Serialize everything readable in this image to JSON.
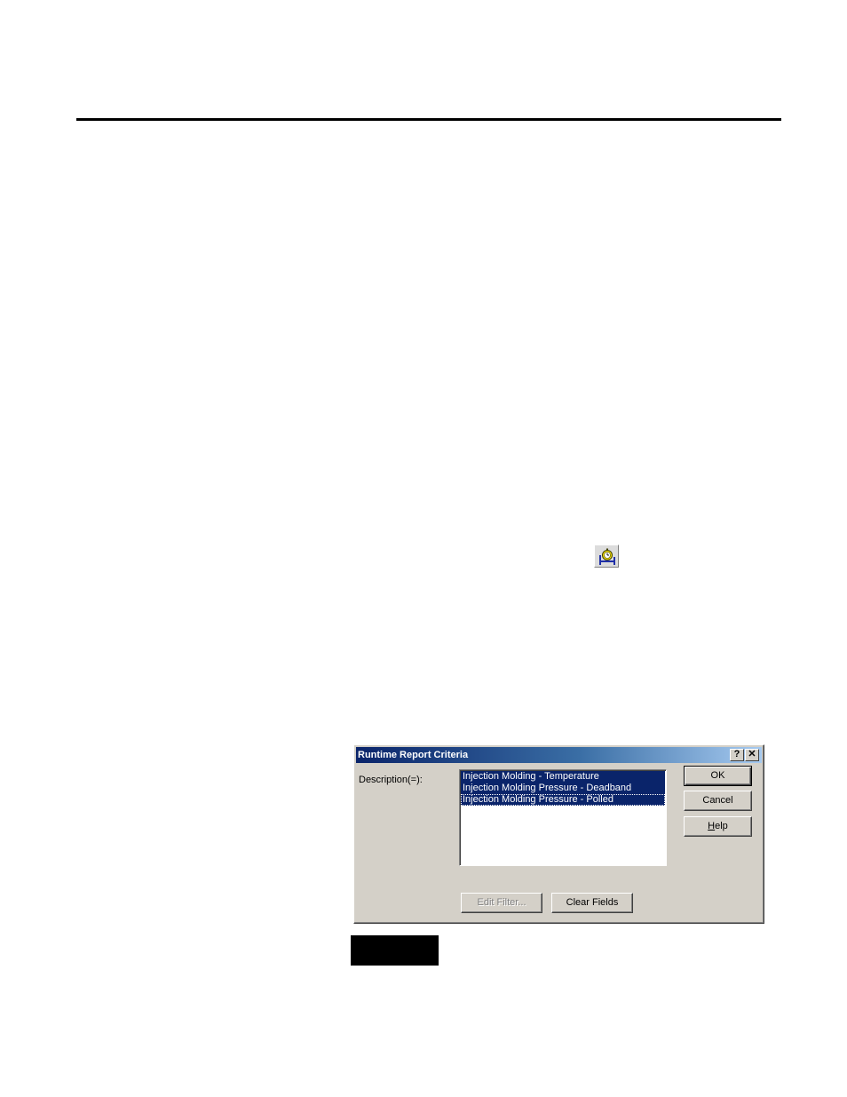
{
  "dialog": {
    "title": "Runtime Report Criteria",
    "help_button": "?",
    "close_button": "✕",
    "description_label": "Description(=):",
    "list_items": [
      {
        "label": "Injection Molding - Temperature",
        "selected": true
      },
      {
        "label": "Injection Molding Pressure - Deadband",
        "selected": true
      },
      {
        "label": "Injection Molding Pressure - Polled",
        "selected": true,
        "focused": true
      }
    ],
    "ok_label": "OK",
    "cancel_label": "Cancel",
    "help_label_rest": "elp",
    "help_label_mnemonic": "H",
    "edit_filter_label": "Edit Filter...",
    "clear_fields_label": "Clear Fields"
  },
  "toolbar_icon": "runtime-report-icon",
  "colors": {
    "selection": "#0a246a",
    "dialog_face": "#d4d0c8"
  }
}
